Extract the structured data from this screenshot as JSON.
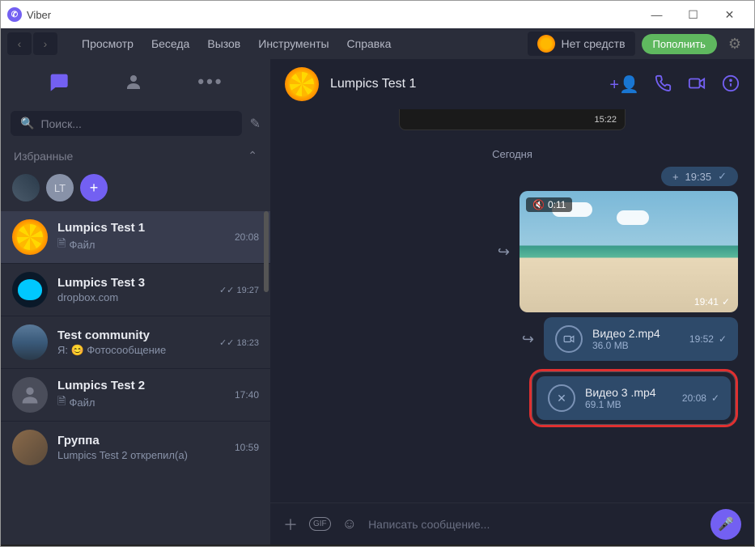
{
  "window": {
    "title": "Viber"
  },
  "menubar": {
    "items": [
      "Просмотр",
      "Беседа",
      "Вызов",
      "Инструменты",
      "Справка"
    ],
    "balance_label": "Нет средств",
    "topup_label": "Пополнить"
  },
  "sidebar": {
    "search_placeholder": "Поиск...",
    "favorites_label": "Избранные",
    "fav_lt": "LT",
    "chats": [
      {
        "name": "Lumpics Test 1",
        "preview": "Файл",
        "time": "20:08",
        "icon": "file",
        "selected": true
      },
      {
        "name": "Lumpics Test 3",
        "preview": "dropbox.com",
        "time": "19:27",
        "read": true
      },
      {
        "name": "Test community",
        "preview": "Я: 😊 Фотосообщение",
        "time": "18:23",
        "read": true
      },
      {
        "name": "Lumpics Test 2",
        "preview": "Файл",
        "time": "17:40",
        "icon": "file"
      },
      {
        "name": "Группа",
        "preview": "Lumpics Test 2 открепил(а)",
        "time": "10:59"
      }
    ]
  },
  "chat": {
    "title": "Lumpics Test 1",
    "old_video_time": "15:22",
    "day_separator": "Сегодня",
    "collapse": {
      "plus": "+",
      "time": "19:35"
    },
    "beach": {
      "duration": "0:11",
      "time": "19:41"
    },
    "file1": {
      "name": "Видео 2.mp4",
      "size": "36.0 MB",
      "time": "19:52"
    },
    "file2": {
      "name": "Видео 3 .mp4",
      "size": "69.1 MB",
      "time": "20:08"
    }
  },
  "composer": {
    "placeholder": "Написать сообщение..."
  }
}
